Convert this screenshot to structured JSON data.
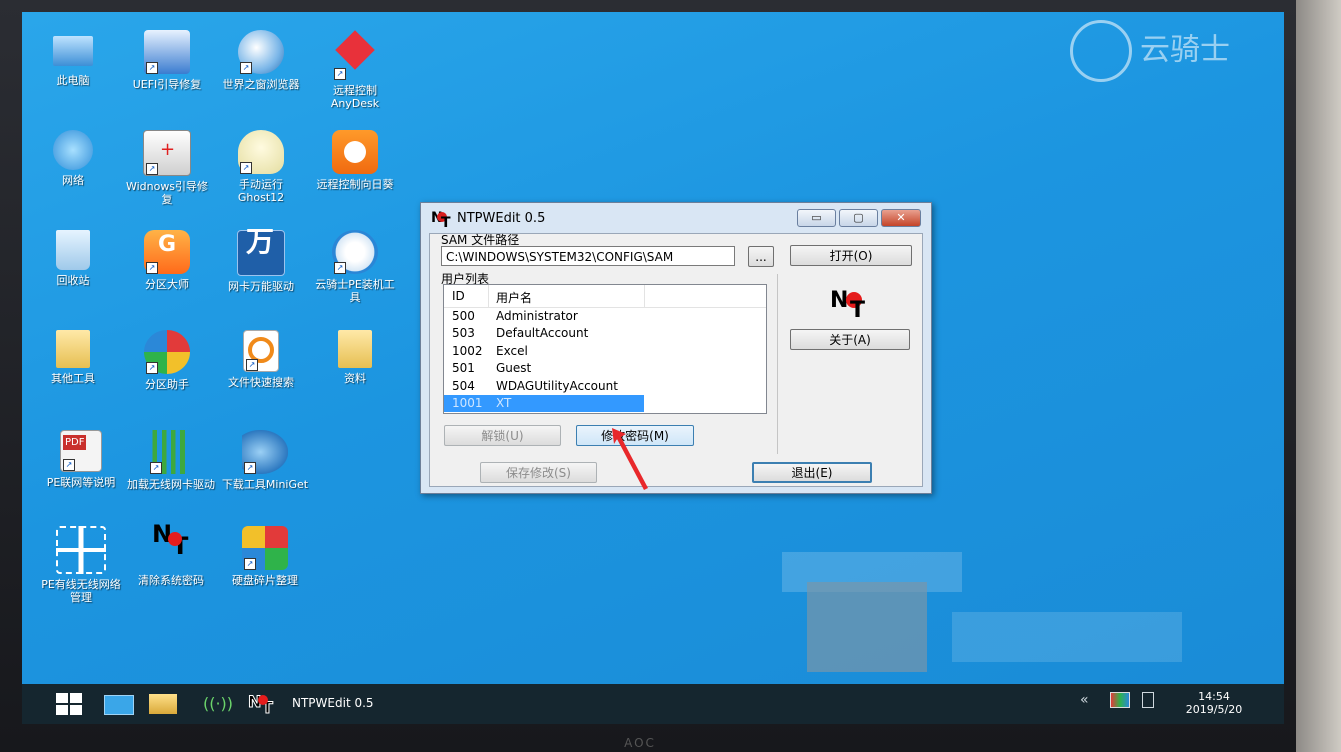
{
  "desktop": {
    "icons": [
      {
        "label": "此电脑",
        "icon": "computer-icon"
      },
      {
        "label": "UEFI引导修复",
        "icon": "monitor-tool-icon"
      },
      {
        "label": "世界之窗浏览器",
        "icon": "globe-icon"
      },
      {
        "label": "远程控制AnyDesk",
        "icon": "anydesk-icon"
      },
      {
        "label": "网络",
        "icon": "network-globe-icon"
      },
      {
        "label": "Widnows引导修复",
        "icon": "medkit-icon"
      },
      {
        "label": "手动运行Ghost12",
        "icon": "ghost-icon"
      },
      {
        "label": "远程控制向日葵",
        "icon": "sunflower-icon"
      },
      {
        "label": "回收站",
        "icon": "recycle-bin-icon"
      },
      {
        "label": "分区大师",
        "icon": "partition-master-icon"
      },
      {
        "label": "网卡万能驱动",
        "icon": "wan-driver-icon"
      },
      {
        "label": "云骑士PE装机工具",
        "icon": "knight-icon"
      },
      {
        "label": "其他工具",
        "icon": "folder-icon"
      },
      {
        "label": "分区助手",
        "icon": "partition-assistant-icon"
      },
      {
        "label": "文件快速搜索",
        "icon": "file-search-icon"
      },
      {
        "label": "资料",
        "icon": "folder-icon"
      },
      {
        "label": "PE联网等说明",
        "icon": "pdf-icon"
      },
      {
        "label": "加载无线网卡驱动",
        "icon": "wifi-bars-icon"
      },
      {
        "label": "下载工具MiniGet",
        "icon": "fish-icon"
      },
      {
        "label": "PE有线无线网络管理",
        "icon": "network-diagram-icon"
      },
      {
        "label": "清除系统密码",
        "icon": "ntpw-key-icon"
      },
      {
        "label": "硬盘碎片整理",
        "icon": "defrag-cubes-icon"
      }
    ]
  },
  "watermark": {
    "text": "云骑士"
  },
  "window": {
    "title": "NTPWEdit 0.5",
    "minimize": "▭",
    "maximize": "▢",
    "close": "✕",
    "sam_label": "SAM 文件路径",
    "sam_path": "C:\\WINDOWS\\SYSTEM32\\CONFIG\\SAM",
    "browse": "...",
    "open": "打开(O)",
    "user_list_label": "用户列表",
    "columns": {
      "id": "ID",
      "name": "用户名"
    },
    "users": [
      {
        "id": "500",
        "name": "Administrator"
      },
      {
        "id": "503",
        "name": "DefaultAccount"
      },
      {
        "id": "1002",
        "name": "Excel"
      },
      {
        "id": "501",
        "name": "Guest"
      },
      {
        "id": "504",
        "name": "WDAGUtilityAccount"
      },
      {
        "id": "1001",
        "name": "XT"
      }
    ],
    "selected_user_id": "1001",
    "about": "关于(A)",
    "unlock": "解锁(U)",
    "change_password": "修改密码(M)",
    "save": "保存修改(S)",
    "exit": "退出(E)"
  },
  "taskbar": {
    "active_app": "NTPWEdit 0.5",
    "tray_expand": "«",
    "time": "14:54",
    "date": "2019/5/20"
  },
  "monitor_brand": "AOC",
  "colors": {
    "desktop": "#1c95e0",
    "selection": "#3399ff",
    "taskbar": "#15262f"
  }
}
